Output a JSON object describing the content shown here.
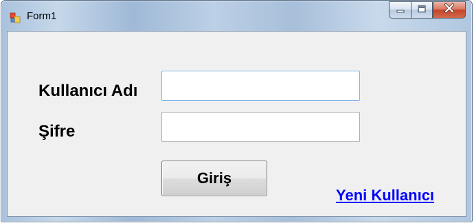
{
  "window": {
    "title": "Form1",
    "icon": "form-app-icon",
    "caption_buttons": [
      "minimize-icon",
      "maximize-icon",
      "close-icon"
    ]
  },
  "form": {
    "username_label": "Kullanıcı Adı",
    "username_value": "",
    "password_label": "Şifre",
    "password_value": "",
    "login_button": "Giriş",
    "new_user_link": "Yeni Kullanıcı"
  },
  "colors": {
    "link": "#0000ff",
    "client_background": "#f0f0f0",
    "close_button": "#c4452a"
  }
}
